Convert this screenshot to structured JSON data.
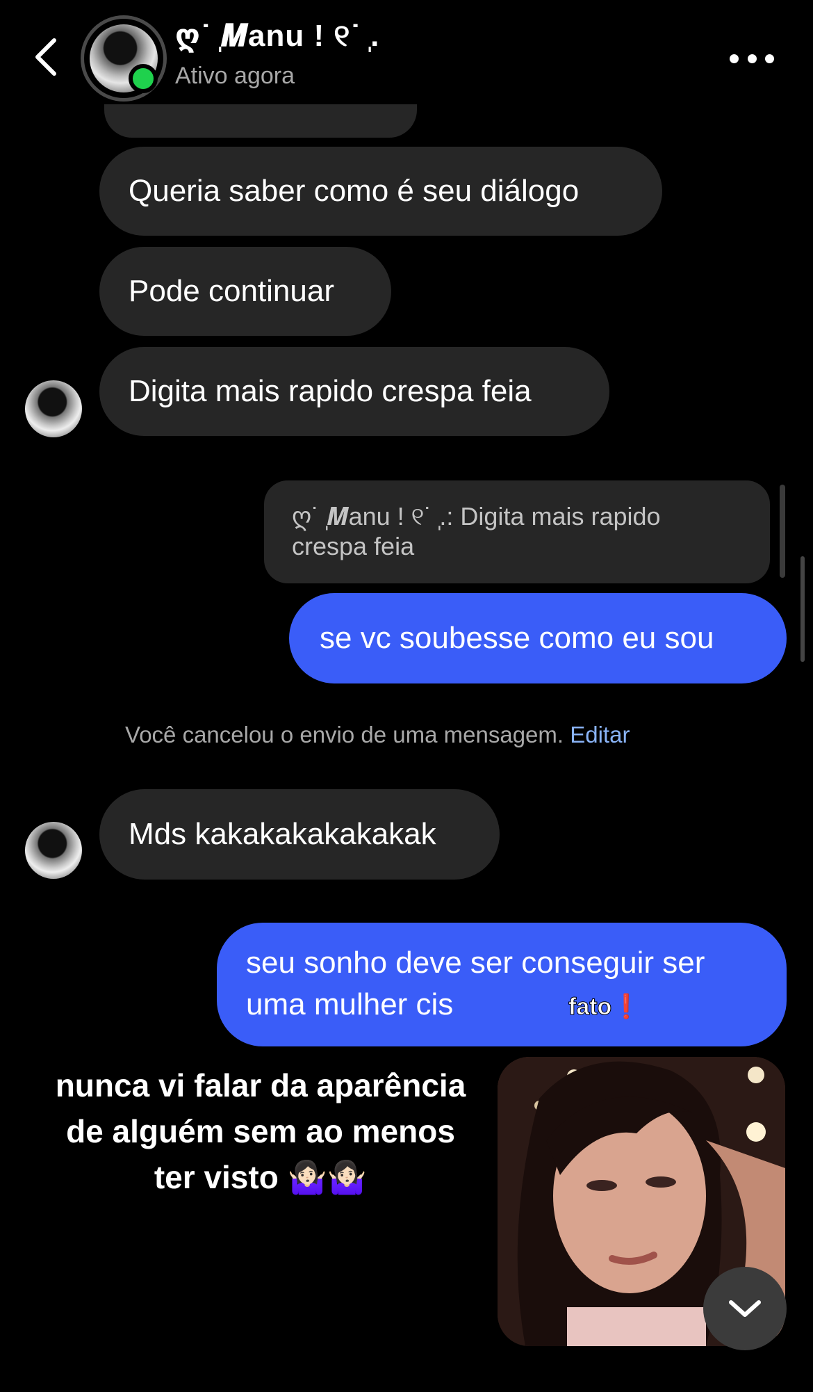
{
  "header": {
    "contact_name": "ღ˙ ̩𝑴anu ! ୧˙ ̩.",
    "status": "Ativo agora",
    "back_icon": "chevron-left-icon",
    "more_icon": "more-horizontal-icon"
  },
  "messages": {
    "m1": "Queria saber como é seu diálogo",
    "m2": "Pode continuar",
    "m3": "Digita mais rapido crespa feia",
    "reply_quote": "ღ˙ ̩𝑴anu ! ୧˙ ̩.: Digita mais rapido crespa feia",
    "m4": "se vc soubesse como eu sou",
    "system_note": "Você cancelou o envio de uma mensagem.",
    "system_edit": "Editar",
    "m5": "Mds kakakakakakakak",
    "m6": "seu sonho deve ser conseguir ser uma mulher cis",
    "m6_overlay": "fato",
    "m6_overlay_mark": "❗"
  },
  "overlay_caption": "nunca vi falar da aparência de alguém sem ao menos ter visto 🤷🏻‍♀️🤷🏻‍♀️",
  "colors": {
    "outgoing_bubble": "#3a5df8",
    "incoming_bubble": "#262626",
    "online": "#1fd14d",
    "edit_link": "#8ab4f8"
  }
}
